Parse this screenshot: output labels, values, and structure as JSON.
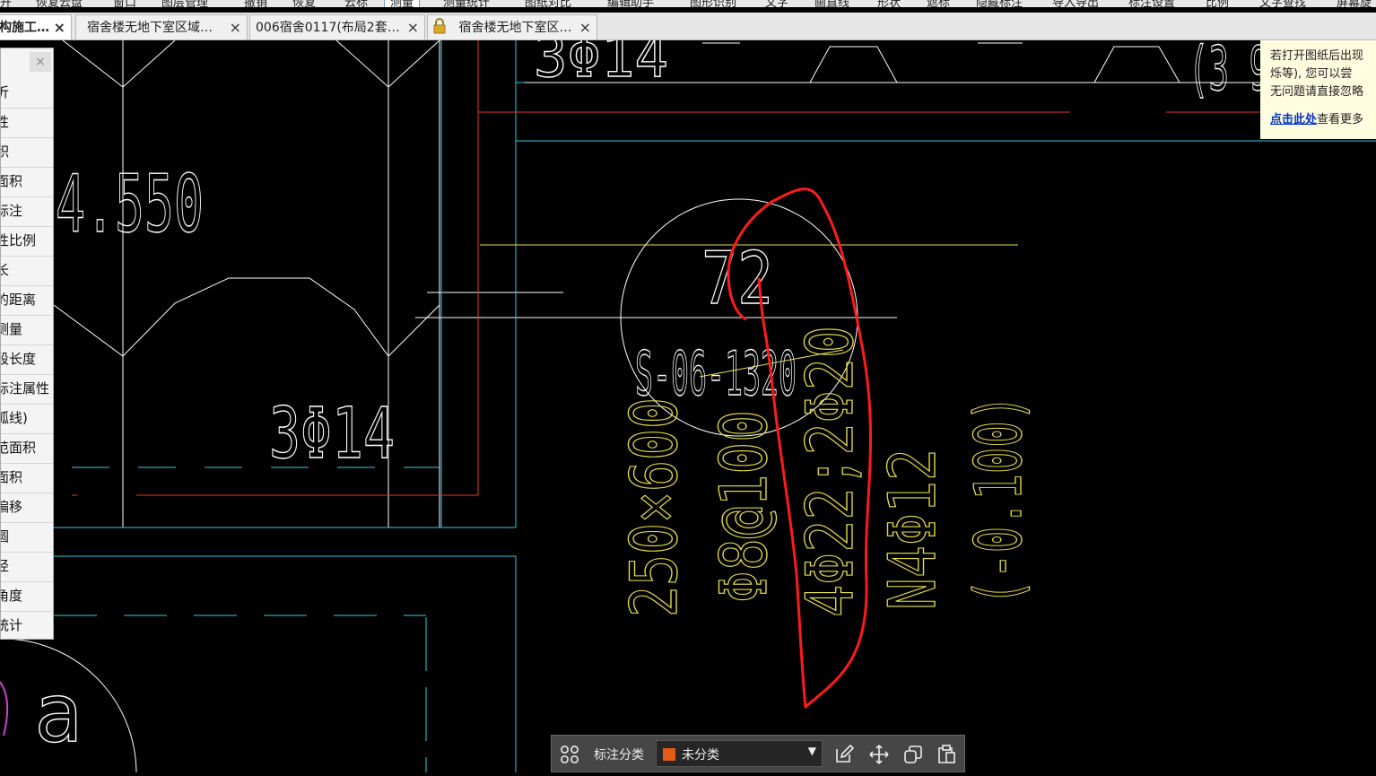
{
  "toolbar": {
    "items": [
      "开",
      "恢复云盘",
      "窗口",
      "图层管理",
      "撤销",
      "恢复",
      "云标",
      "测量",
      "测量统计",
      "图纸对比",
      "编辑助手",
      "图形识别",
      "文字",
      "画直线",
      "形状",
      "遮标",
      "隐藏标注",
      "导入导出",
      "标注设置",
      "比例",
      "文字查找",
      "屏幕旋"
    ],
    "active_index": 7
  },
  "tabs": [
    {
      "label": "构施工…",
      "active": true,
      "locked": false
    },
    {
      "label": "宿舍楼无地下室区域…",
      "active": false,
      "locked": false
    },
    {
      "label": "006宿舍0117(布局2套…",
      "active": false,
      "locked": false
    },
    {
      "label": "宿舍楼无地下室区…",
      "active": false,
      "locked": true
    }
  ],
  "side_panel": {
    "close": "×",
    "items": [
      "沂",
      "性",
      "积",
      "面积",
      "标注",
      "性比例",
      "长",
      "的距离",
      "测量",
      "段长度",
      "标注属性",
      "弧线)",
      "范面积",
      "面积",
      "偏移",
      "圆",
      "径",
      "角度",
      "统计"
    ]
  },
  "notice": {
    "lines": [
      "若打开图纸后出现",
      "烁等), 您可以尝",
      "无问题请直接忽略"
    ],
    "link": "点击此处",
    "link_suffix": "查看更多"
  },
  "drawing": {
    "level": "4.550",
    "rebar_left": "3Φ14",
    "rebar_top": "3Φ14",
    "top_right_partial": "(3 9",
    "bubble_number": "72",
    "beam_id": "S-06-1320",
    "beam_size": "250×600",
    "stirrup": "Φ8@100",
    "top_bars": "4Φ22;2Φ20",
    "side_bars": "N4Φ12",
    "offset": "(-0.100)",
    "grid_letter": "a"
  },
  "bottom_bar": {
    "label": "标注分类",
    "selected": "未分类",
    "swatch_color": "#e65c16"
  }
}
